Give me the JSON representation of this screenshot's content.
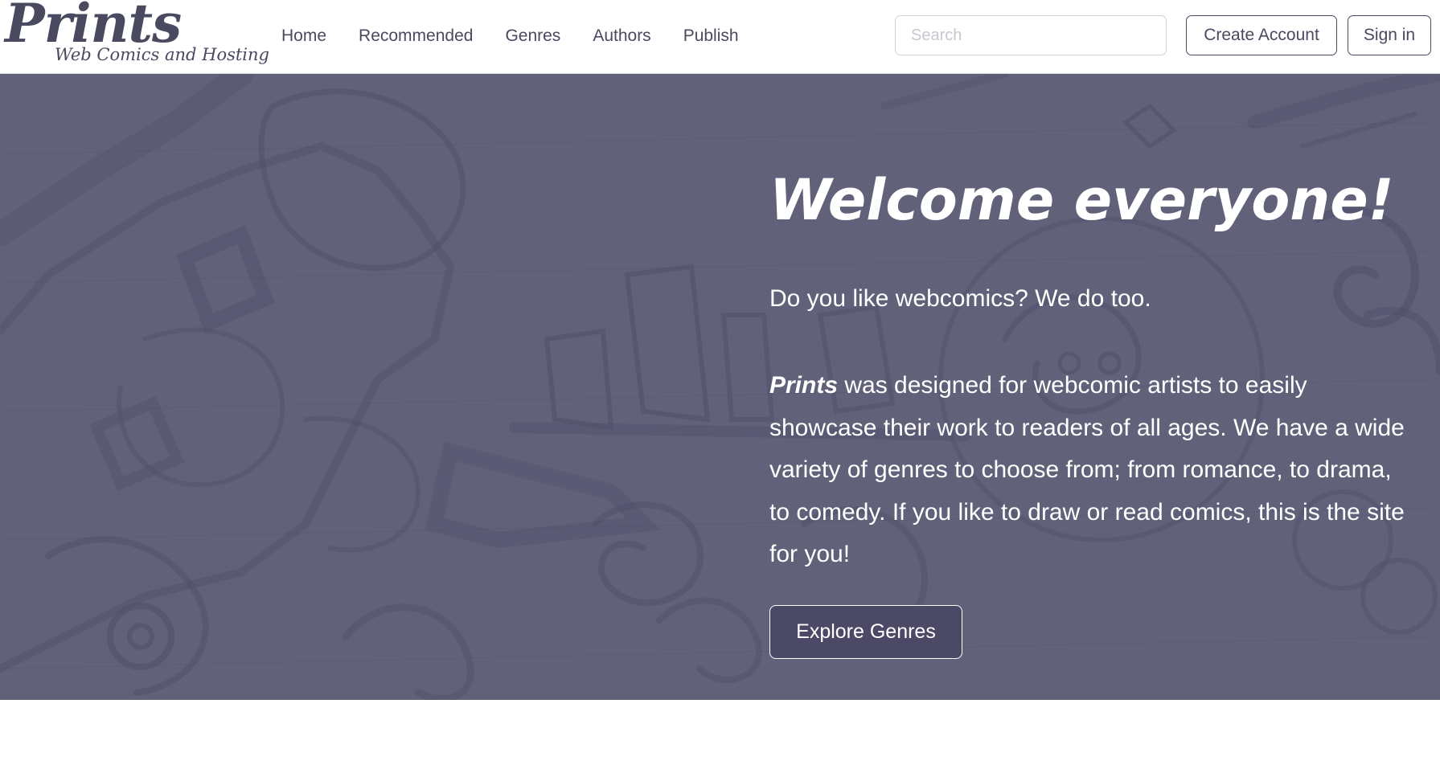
{
  "brand": {
    "name": "Prints",
    "tagline": "Web Comics and Hosting"
  },
  "nav": {
    "items": [
      {
        "label": "Home"
      },
      {
        "label": "Recommended"
      },
      {
        "label": "Genres"
      },
      {
        "label": "Authors"
      },
      {
        "label": "Publish"
      }
    ]
  },
  "search": {
    "placeholder": "Search",
    "value": ""
  },
  "auth": {
    "create_account_label": "Create Account",
    "sign_in_label": "Sign in"
  },
  "hero": {
    "title": "Welcome everyone!",
    "intro": "Do you like webcomics? We do too.",
    "description_brand": "Prints",
    "description_rest": " was designed for webcomic artists to easily showcase their work to readers of all ages. We have a wide variety of genres to choose from; from romance, to drama, to comedy. If you like to draw or read comics, this is the site for you!",
    "cta_label": "Explore Genres"
  },
  "colors": {
    "brand": "#494960",
    "hero_bg": "#62627a",
    "cta_bg": "#4b4966",
    "text_light": "#ffffff"
  },
  "icons": {
    "hero_background": "sketch-doodle-background"
  }
}
